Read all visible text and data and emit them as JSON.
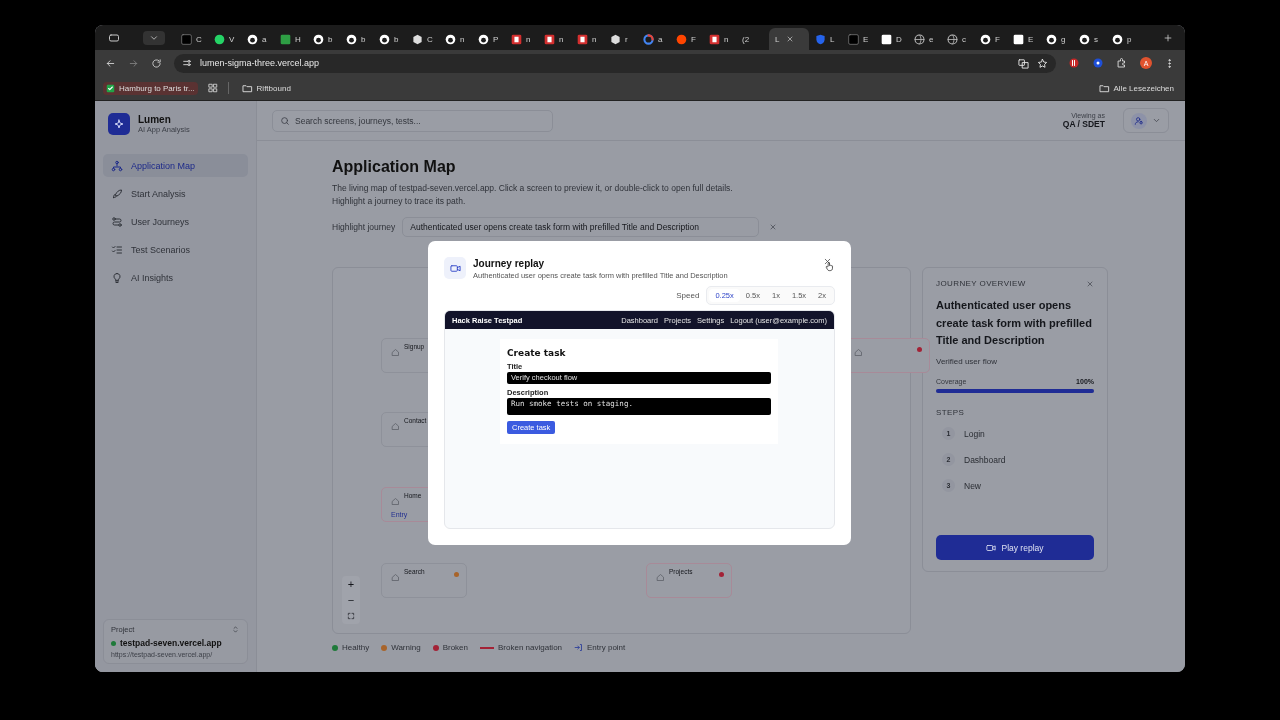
{
  "browser": {
    "tabs": [
      {
        "title": "C",
        "kind": "dark",
        "selected": false
      },
      {
        "title": "V",
        "kind": "whatsapp",
        "selected": false
      },
      {
        "title": "a",
        "kind": "github",
        "selected": false
      },
      {
        "title": "H",
        "kind": "green",
        "selected": false
      },
      {
        "title": "b",
        "kind": "github",
        "selected": false
      },
      {
        "title": "b",
        "kind": "github",
        "selected": false
      },
      {
        "title": "b",
        "kind": "github",
        "selected": false
      },
      {
        "title": "C",
        "kind": "generic",
        "selected": false
      },
      {
        "title": "n",
        "kind": "github",
        "selected": false
      },
      {
        "title": "P",
        "kind": "github",
        "selected": false
      },
      {
        "title": "n",
        "kind": "red",
        "selected": false
      },
      {
        "title": "n",
        "kind": "red",
        "selected": false
      },
      {
        "title": "n",
        "kind": "red",
        "selected": false
      },
      {
        "title": "r",
        "kind": "generic",
        "selected": false
      },
      {
        "title": "a",
        "kind": "google",
        "selected": false
      },
      {
        "title": "F",
        "kind": "orange",
        "selected": false
      },
      {
        "title": "n",
        "kind": "red",
        "selected": false
      },
      {
        "title": "(2",
        "kind": "none",
        "selected": false
      },
      {
        "title": "L",
        "kind": "none",
        "selected": true
      },
      {
        "title": "L",
        "kind": "blue",
        "selected": false
      },
      {
        "title": "E",
        "kind": "dark",
        "selected": false
      },
      {
        "title": "D",
        "kind": "white",
        "selected": false
      },
      {
        "title": "e",
        "kind": "globe",
        "selected": false
      },
      {
        "title": "c",
        "kind": "globe",
        "selected": false
      },
      {
        "title": "F",
        "kind": "github",
        "selected": false
      },
      {
        "title": "E",
        "kind": "white",
        "selected": false
      },
      {
        "title": "g",
        "kind": "github",
        "selected": false
      },
      {
        "title": "s",
        "kind": "github",
        "selected": false
      },
      {
        "title": "p",
        "kind": "github",
        "selected": false
      }
    ],
    "address": "lumen-sigma-three.vercel.app",
    "profile": "A",
    "bookmarks": [
      {
        "kind": "page",
        "label": "Hamburg to Paris tr..."
      },
      {
        "kind": "folder",
        "label": "Riftbound"
      }
    ],
    "all_bookmarks": "Alle Lesezeichen"
  },
  "sidebar": {
    "brand": "Lumen",
    "tagline": "AI App Analysis",
    "items": [
      {
        "label": "Application Map",
        "selected": true
      },
      {
        "label": "Start Analysis",
        "selected": false
      },
      {
        "label": "User Journeys",
        "selected": false
      },
      {
        "label": "Test Scenarios",
        "selected": false
      },
      {
        "label": "AI Insights",
        "selected": false
      }
    ],
    "project": {
      "label": "Project",
      "name": "testpad-seven.vercel.app",
      "url": "https://testpad-seven.vercel.app/"
    }
  },
  "header": {
    "search": {
      "placeholder": "Search screens, journeys, tests..."
    },
    "viewing_label": "Viewing as",
    "role": "QA / SDET"
  },
  "page": {
    "title": "Application Map",
    "description": "The living map of testpad-seven.vercel.app. Click a screen to preview it, or double-click to open full details. Highlight a journey to trace its path.",
    "highlight_label": "Highlight journey",
    "highlight_value": "Authenticated user opens create task form with prefilled Title and Description"
  },
  "canvas": {
    "nodes": [
      {
        "name": "Signup",
        "broken_link": false
      },
      {
        "name": "Contact",
        "broken_link": false
      },
      {
        "name": "Home",
        "entry_tag": "Entry",
        "broken_link": true
      },
      {
        "name": "Search",
        "color": "#a8642a",
        "broken_link": false
      },
      {
        "name": "Projects",
        "color": "#a32236",
        "broken_link": true
      },
      {
        "color": "#a32236",
        "broken_link": true
      }
    ],
    "controls": [
      "+",
      "−"
    ]
  },
  "legend": [
    {
      "kind": "dot",
      "label": "Healthy",
      "color": "#1f7a3a"
    },
    {
      "kind": "dot",
      "label": "Warning",
      "color": "#a8642a"
    },
    {
      "kind": "dot",
      "label": "Broken",
      "color": "#a32236"
    },
    {
      "kind": "line",
      "label": "Broken navigation",
      "color": "#a32236"
    },
    {
      "kind": "entry",
      "label": "Entry point",
      "color": "#34459c"
    }
  ],
  "overview": {
    "heading": "JOURNEY OVERVIEW",
    "title": "Authenticated user opens create task form with prefilled Title and Description",
    "subtitle": "Verified user flow",
    "coverage_label": "Coverage",
    "coverage_value": "100%",
    "level": 1.0,
    "steps_heading": "STEPS",
    "steps": [
      {
        "number": "1",
        "label": "Login"
      },
      {
        "number": "2",
        "label": "Dashboard"
      },
      {
        "number": "3",
        "label": "New"
      }
    ],
    "button": "Play replay"
  },
  "modal": {
    "title": "Journey replay",
    "subtitle": "Authenticated user opens create task form with prefilled Title and Description",
    "speed_label": "Speed",
    "speeds": [
      {
        "label": "0.25x",
        "selected": true
      },
      {
        "label": "0.5x",
        "selected": false
      },
      {
        "label": "1x",
        "selected": false
      },
      {
        "label": "1.5x",
        "selected": false
      },
      {
        "label": "2x",
        "selected": false
      }
    ],
    "replay": {
      "brand": "Hack Raise Testpad",
      "nav": [
        "Dashboard",
        "Projects",
        "Settings",
        "Logout (user@example.com)"
      ],
      "heading": "Create task",
      "fields": [
        {
          "label": "Title",
          "value": "Verify checkout flow",
          "kind": "input"
        },
        {
          "label": "Description",
          "value": "Run smoke tests on staging.",
          "kind": "textarea"
        }
      ],
      "button": "Create task"
    }
  }
}
